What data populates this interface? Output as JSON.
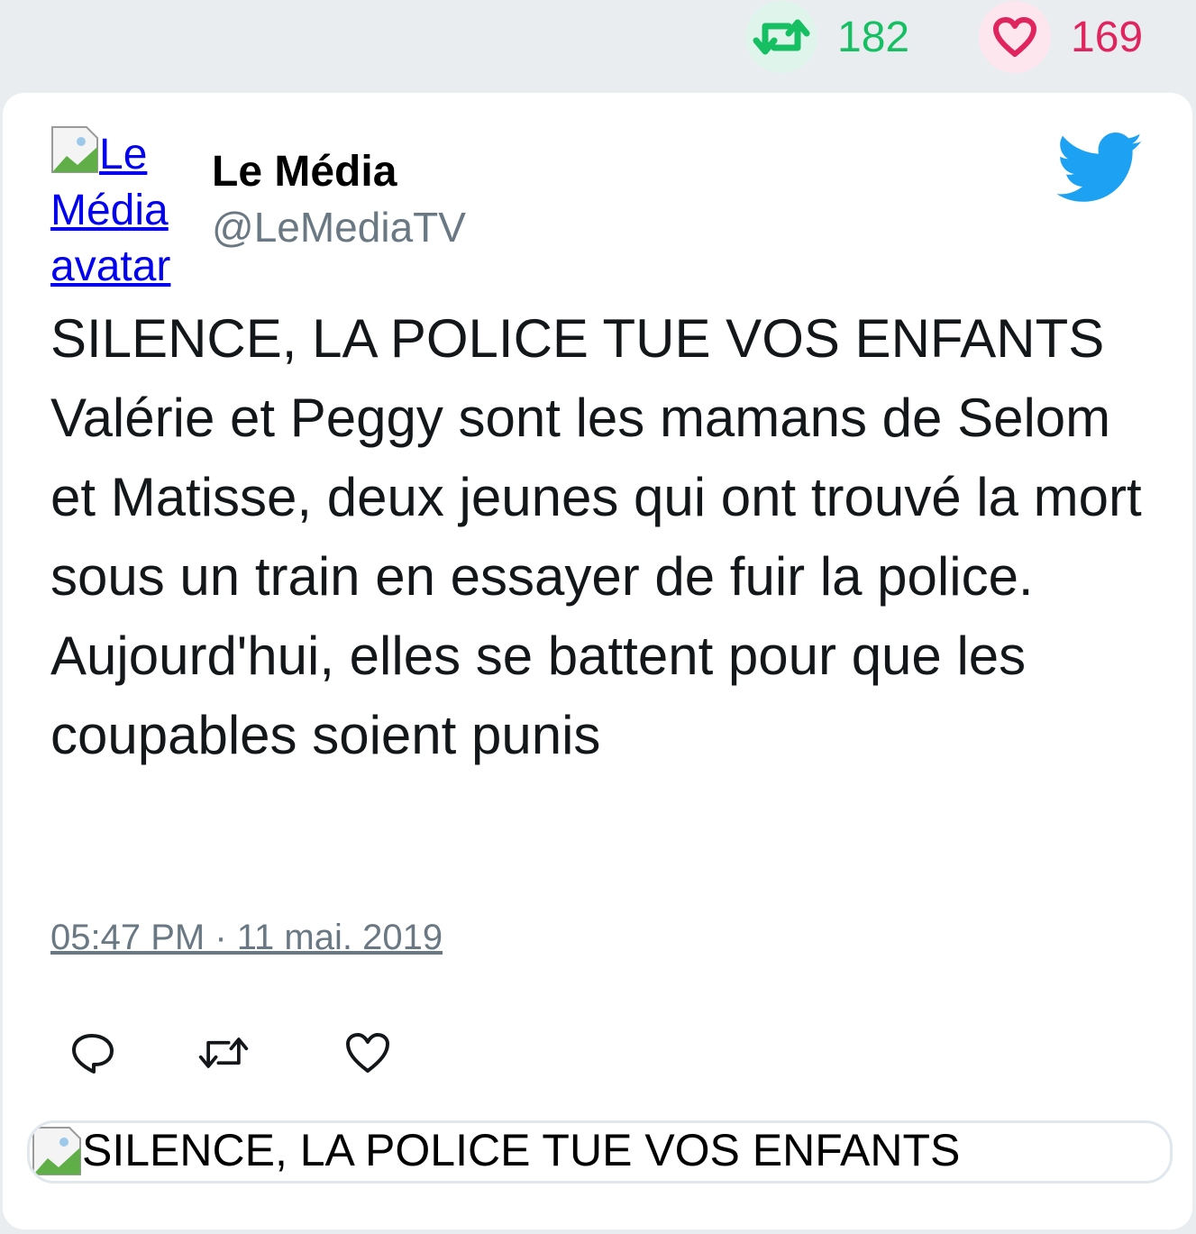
{
  "stats": {
    "retweets": "182",
    "likes": "169",
    "retweet_color": "#17bf63",
    "like_color": "#e0245e"
  },
  "tweet": {
    "avatar_alt_lines": [
      "Le",
      "Média",
      "avatar"
    ],
    "author_name": "Le Média",
    "author_handle": "@LeMediaTV",
    "text": "SILENCE, LA POLICE TUE VOS ENFANTS Valérie et Peggy sont les mamans de Selom et Matisse, deux jeunes qui ont trouvé la mort sous un train en essayer de fuir la police. Aujourd'hui, elles se battent pour que les coupables soient punis",
    "timestamp": "05:47 PM · 11 mai. 2019",
    "brand_icon": "twitter-bird-icon",
    "brand_color": "#1da1f2"
  },
  "actions": {
    "reply_icon": "reply-icon",
    "retweet_icon": "retweet-icon",
    "like_icon": "heart-icon"
  },
  "link_card": {
    "image_alt": "SILENCE, LA POLICE TUE VOS ENFANTS"
  }
}
